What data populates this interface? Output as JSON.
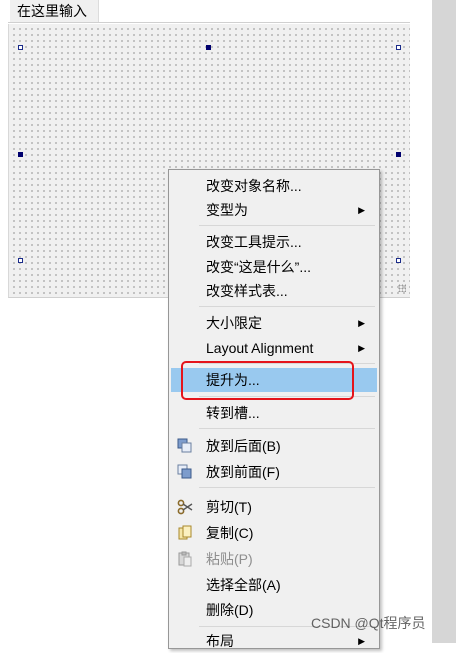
{
  "form": {
    "menu_placeholder": "在这里输入"
  },
  "context_menu": {
    "items": [
      {
        "label": "改变对象名称..."
      },
      {
        "label": "变型为"
      },
      {
        "label": "改变工具提示..."
      },
      {
        "label": "改变“这是什么”..."
      },
      {
        "label": "改变样式表..."
      },
      {
        "label": "大小限定"
      },
      {
        "label": "Layout Alignment"
      },
      {
        "label": "提升为..."
      },
      {
        "label": "转到槽..."
      },
      {
        "label": "放到后面(B)"
      },
      {
        "label": "放到前面(F)"
      },
      {
        "label": "剪切(T)"
      },
      {
        "label": "复制(C)"
      },
      {
        "label": "粘贴(P)"
      },
      {
        "label": "选择全部(A)"
      },
      {
        "label": "删除(D)"
      },
      {
        "label": "布局"
      }
    ],
    "highlighted": "提升为...",
    "disabled": [
      "粘贴(P)"
    ]
  },
  "watermark": "CSDN @Qt程序员",
  "colors": {
    "highlight": "#99c9ef",
    "annotation_box": "#e5141a",
    "selection_handle": "#00006e"
  }
}
